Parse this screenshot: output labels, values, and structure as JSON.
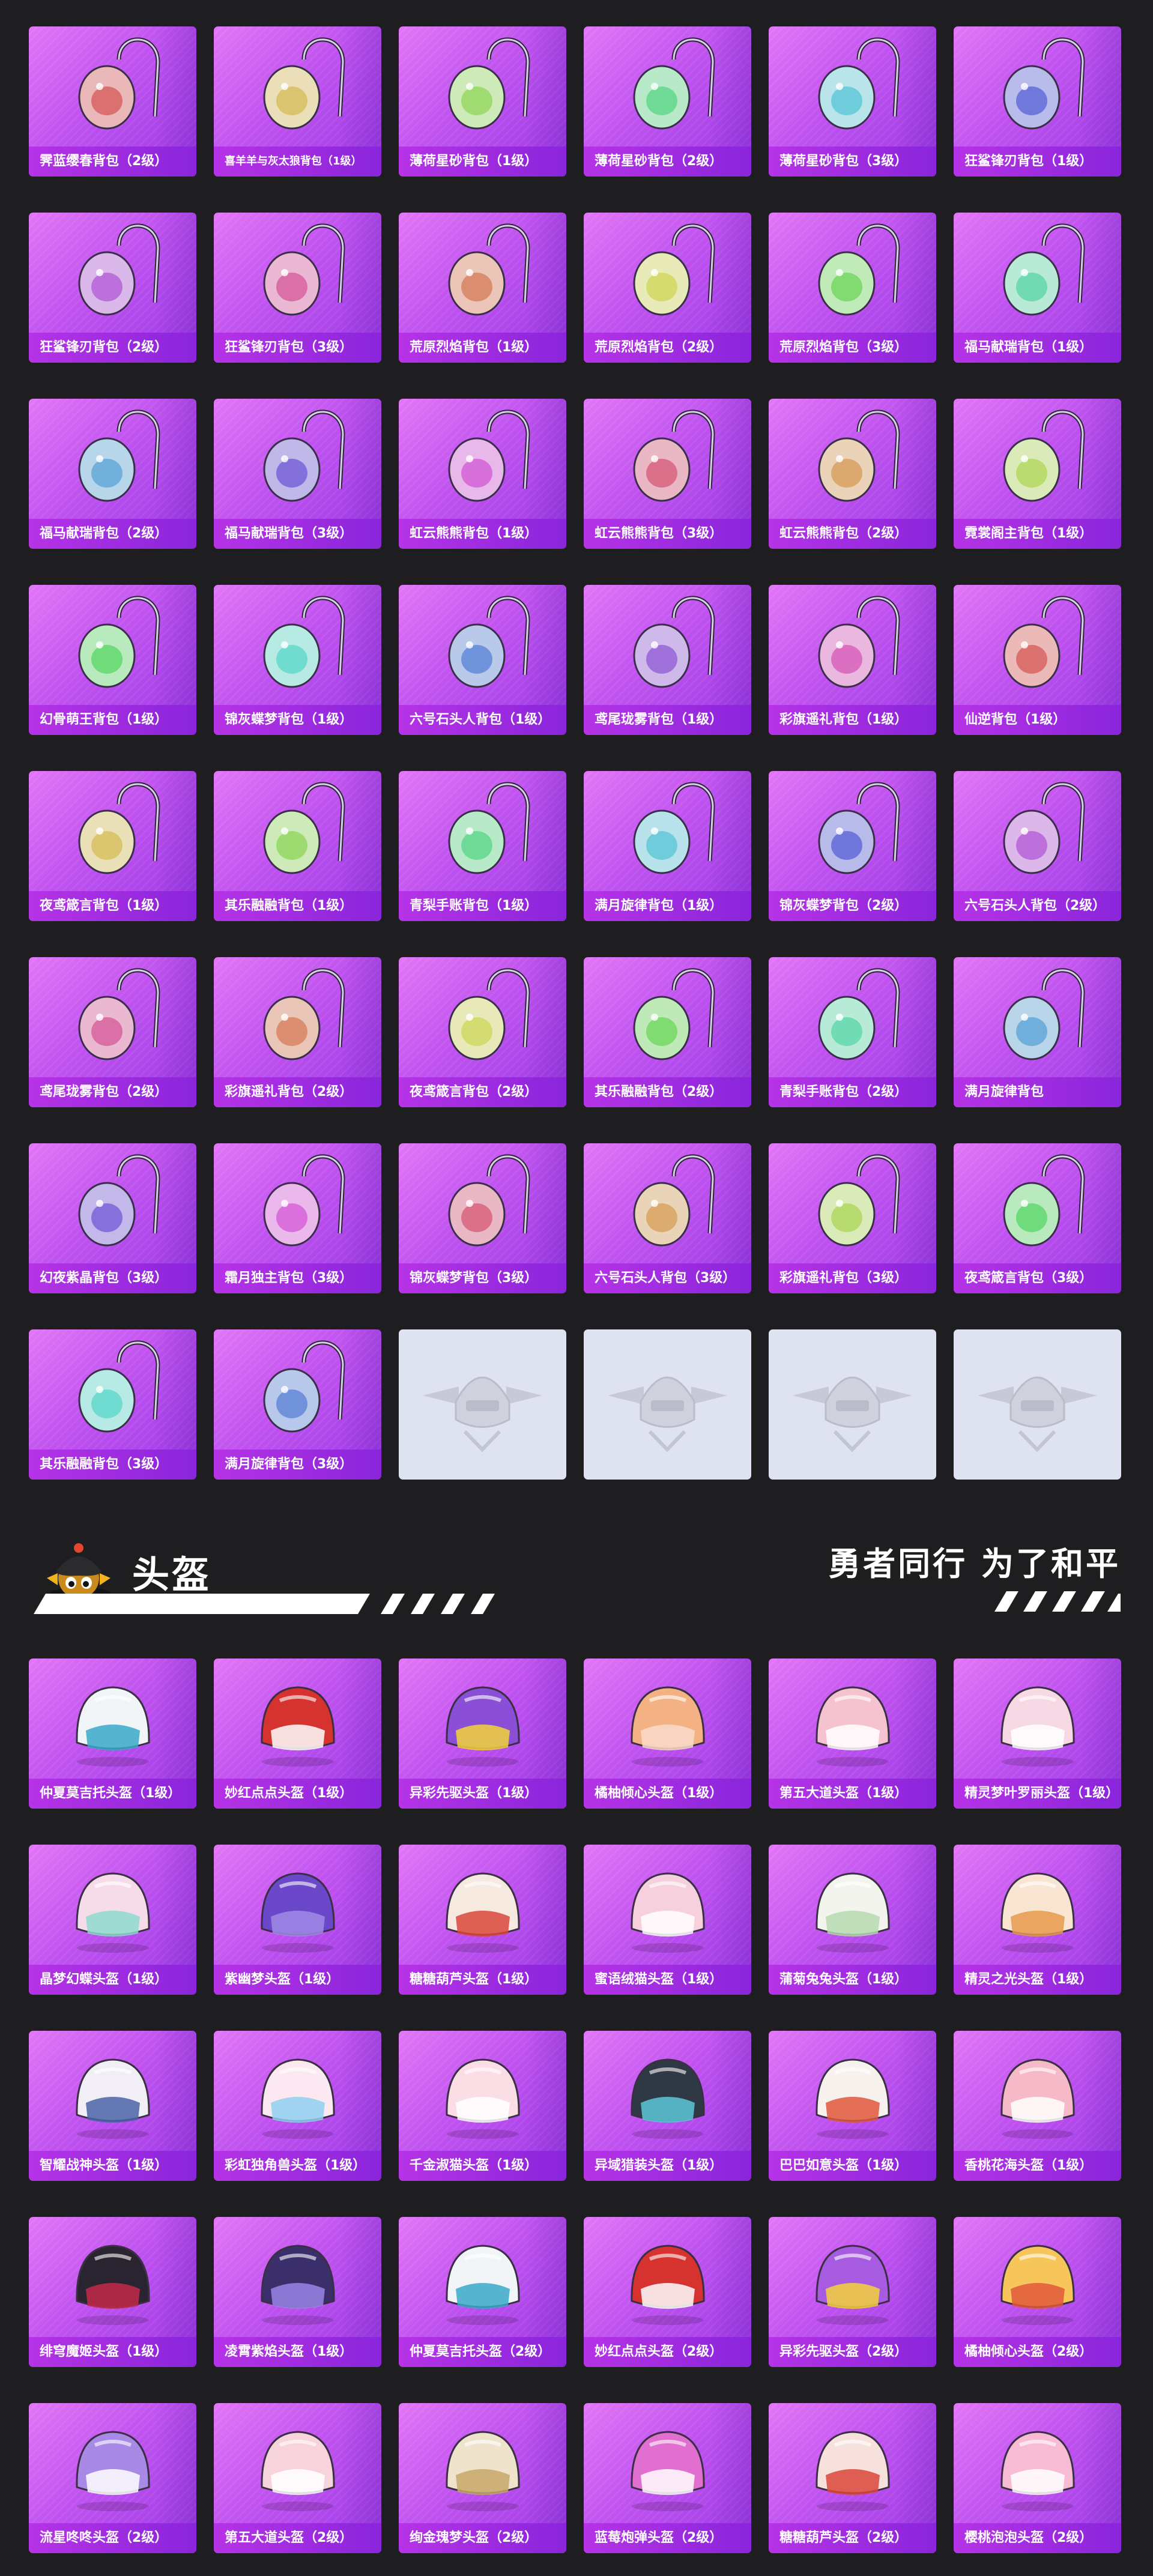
{
  "backpacks": [
    {
      "label": "霁蓝缨春背包（2级）",
      "icon": "mask-backpack-icon"
    },
    {
      "label": "喜羊羊与灰太狼背包（1级）",
      "icon": "sheep-backpack-icon",
      "small": true
    },
    {
      "label": "薄荷星砂背包（1级）",
      "icon": "mint-backpack-icon"
    },
    {
      "label": "薄荷星砂背包（2级）",
      "icon": "mint-backpack-icon"
    },
    {
      "label": "薄荷星砂背包（3级）",
      "icon": "mint-backpack-icon"
    },
    {
      "label": "狂鲨锋刃背包（1级）",
      "icon": "shark-backpack-icon"
    },
    {
      "label": "狂鲨锋刃背包（2级）",
      "icon": "shark-backpack-icon"
    },
    {
      "label": "狂鲨锋刃背包（3级）",
      "icon": "shark-backpack-icon"
    },
    {
      "label": "荒原烈焰背包（1级）",
      "icon": "flame-backpack-icon"
    },
    {
      "label": "荒原烈焰背包（2级）",
      "icon": "flame-backpack-icon"
    },
    {
      "label": "荒原烈焰背包（3级）",
      "icon": "flame-backpack-icon"
    },
    {
      "label": "福马献瑞背包（1级）",
      "icon": "horse-backpack-icon"
    },
    {
      "label": "福马献瑞背包（2级）",
      "icon": "horse-backpack-icon"
    },
    {
      "label": "福马献瑞背包（3级）",
      "icon": "horse-backpack-icon"
    },
    {
      "label": "虹云熊熊背包（1级）",
      "icon": "bear-backpack-icon"
    },
    {
      "label": "虹云熊熊背包（3级）",
      "icon": "bear-backpack-icon"
    },
    {
      "label": "虹云熊熊背包（2级）",
      "icon": "bear-backpack-icon"
    },
    {
      "label": "霓裳阁主背包（1级）",
      "icon": "orb-backpack-icon"
    },
    {
      "label": "幻骨萌王背包（1级）",
      "icon": "ghost-backpack-icon"
    },
    {
      "label": "锦灰蝶梦背包（1级）",
      "icon": "crystal-backpack-icon"
    },
    {
      "label": "六号石头人背包（1级）",
      "icon": "stone-backpack-icon"
    },
    {
      "label": "鸢尾珑雾背包（1级）",
      "icon": "pouch-backpack-icon"
    },
    {
      "label": "彩旗遥礼背包（1级）",
      "icon": "flag-backpack-icon"
    },
    {
      "label": "仙逆背包（1级）",
      "icon": "charm-backpack-icon"
    },
    {
      "label": "夜鸢箴言背包（1级）",
      "icon": "night-backpack-icon"
    },
    {
      "label": "其乐融融背包（1级）",
      "icon": "icecream-backpack-icon"
    },
    {
      "label": "青梨手账背包（1级）",
      "icon": "pear-backpack-icon"
    },
    {
      "label": "满月旋律背包（1级）",
      "icon": "moon-backpack-icon"
    },
    {
      "label": "锦灰蝶梦背包（2级）",
      "icon": "crystal-backpack-icon"
    },
    {
      "label": "六号石头人背包（2级）",
      "icon": "stone-backpack-icon"
    },
    {
      "label": "鸢尾珑雾背包（2级）",
      "icon": "pouch-backpack-icon"
    },
    {
      "label": "彩旗遥礼背包（2级）",
      "icon": "flag-backpack-icon"
    },
    {
      "label": "夜鸢箴言背包（2级）",
      "icon": "night-backpack-icon"
    },
    {
      "label": "其乐融融背包（2级）",
      "icon": "icecream-backpack-icon"
    },
    {
      "label": "青梨手账背包（2级）",
      "icon": "pear-backpack-icon"
    },
    {
      "label": "满月旋律背包",
      "icon": "moon-backpack-icon"
    },
    {
      "label": "幻夜紫晶背包（3级）",
      "icon": "amethyst-backpack-icon"
    },
    {
      "label": "霜月独主背包（3级）",
      "icon": "frost-backpack-icon"
    },
    {
      "label": "锦灰蝶梦背包（3级）",
      "icon": "crystal-backpack-icon"
    },
    {
      "label": "六号石头人背包（3级）",
      "icon": "stone-backpack-icon"
    },
    {
      "label": "彩旗遥礼背包（3级）",
      "icon": "flag-backpack-icon"
    },
    {
      "label": "夜鸢箴言背包（3级）",
      "icon": "night-backpack-icon"
    },
    {
      "label": "其乐融融背包（3级）",
      "icon": "icecream-backpack-icon"
    },
    {
      "label": "满月旋律背包（3级）",
      "icon": "moon-backpack-icon"
    }
  ],
  "placeholder_count": 4,
  "placeholder_icon": "emblem-placeholder-icon",
  "helmet_section": {
    "title": "头盔",
    "slogan": "勇者同行 为了和平",
    "icon": "mascot-helmet-icon"
  },
  "helmets": [
    {
      "label": "仲夏莫吉托头盔（1级）",
      "color": "#f2f5f7",
      "accent": "#39a9c9"
    },
    {
      "label": "妙红点点头盔（1级）",
      "color": "#d6322f",
      "accent": "#ffffff"
    },
    {
      "label": "异彩先驱头盔（1级）",
      "color": "#8a4fd6",
      "accent": "#f3d23a"
    },
    {
      "label": "橘柚倾心头盔（1级）",
      "color": "#f4b184",
      "accent": "#f9dccb"
    },
    {
      "label": "第五大道头盔（1级）",
      "color": "#f5c2d0",
      "accent": "#ffffff"
    },
    {
      "label": "精灵梦叶罗丽头盔（1级）",
      "color": "#f6d9e4",
      "accent": "#ffffff"
    },
    {
      "label": "晶梦幻蝶头盔（1级）",
      "color": "#f6dce9",
      "accent": "#8fd9cf"
    },
    {
      "label": "紫幽梦头盔（1级）",
      "color": "#6b47c9",
      "accent": "#a08ae6"
    },
    {
      "label": "糖糖葫芦头盔（1级）",
      "color": "#f6e9e0",
      "accent": "#d9463b"
    },
    {
      "label": "蜜语绒猫头盔（1级）",
      "color": "#f6d0dc",
      "accent": "#ffffff"
    },
    {
      "label": "蒲菊兔兔头盔（1级）",
      "color": "#f4f4ee",
      "accent": "#b7d9b0"
    },
    {
      "label": "精灵之光头盔（1级）",
      "color": "#f9e6d2",
      "accent": "#e89a4c"
    },
    {
      "label": "智耀战神头盔（1级）",
      "color": "#f1eef6",
      "accent": "#4b63a8"
    },
    {
      "label": "彩虹独角兽头盔（1级）",
      "color": "#fbe8f0",
      "accent": "#8fd0f0"
    },
    {
      "label": "千金淑猫头盔（1级）",
      "color": "#fbdde6",
      "accent": "#ffffff"
    },
    {
      "label": "异域猎装头盔（1级）",
      "color": "#2f3946",
      "accent": "#5bc8d9"
    },
    {
      "label": "巴巴如意头盔（1级）",
      "color": "#f7f2ee",
      "accent": "#e0583b"
    },
    {
      "label": "香桃花海头盔（1级）",
      "color": "#f5b9c8",
      "accent": "#ffffff"
    },
    {
      "label": "绯穹魔姬头盔（1级）",
      "color": "#2a2430",
      "accent": "#c2294a"
    },
    {
      "label": "凌霄紫焰头盔（1级）",
      "color": "#3b2f6b",
      "accent": "#9a84e6"
    },
    {
      "label": "仲夏莫吉托头盔（2级）",
      "color": "#f2f5f7",
      "accent": "#39a9c9"
    },
    {
      "label": "妙红点点头盔（2级）",
      "color": "#d6322f",
      "accent": "#ffffff"
    },
    {
      "label": "异彩先驱头盔（2级）",
      "color": "#a65be0",
      "accent": "#f3d23a"
    },
    {
      "label": "橘柚倾心头盔（2级）",
      "color": "#f7c65a",
      "accent": "#e0583b"
    },
    {
      "label": "流星咚咚头盔（2级）",
      "color": "#a88ae6",
      "accent": "#ffffff"
    },
    {
      "label": "第五大道头盔（2级）",
      "color": "#f7d3dc",
      "accent": "#ffffff"
    },
    {
      "label": "绚金瑰梦头盔（2级）",
      "color": "#efe3cc",
      "accent": "#c7a86a"
    },
    {
      "label": "蓝莓炮弹头盔（2级）",
      "color": "#e06fcf",
      "accent": "#ffffff"
    },
    {
      "label": "糖糖葫芦头盔（2级）",
      "color": "#f6e1dc",
      "accent": "#d9463b"
    },
    {
      "label": "樱桃泡泡头盔（2级）",
      "color": "#f7bcd3",
      "accent": "#ffffff"
    }
  ]
}
